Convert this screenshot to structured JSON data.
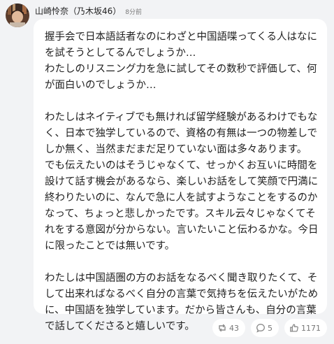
{
  "post": {
    "author_name": "山崎怜奈（乃木坂46）",
    "timestamp": "8分前",
    "body": [
      "握手会で日本語話者なのにわざと中国語喋ってくる人はなにを試そうとしてるんでしょうか…\nわたしのリスニング力を急に試してその数秒で評価して、何が面白いのでしょうか…",
      "わたしはネイティブでも無ければ留学経験があるわけでもなく、日本で独学しているので、資格の有無は一つの物差しでしか無く、当然まだまだ足りていない面は多々あります。\nでも伝えたいのはそうじゃなくて、せっかくお互いに時間を設けて話す機会があるなら、楽しいお話をして笑顔で円満に終わりたいのに、なんで急に人を試すようなことをするのかなって、ちょっと悲しかったです。スキル云々じゃなくてそれをする意図が分からない。言いたいこと伝わるかな。今日に限ったことでは無いです。",
      "わたしは中国語圏の方のお話をなるべく聞き取りたくて、そして出来ればなるべく自分の言葉で気持ちを伝えたいがために、中国語を独学しています。だから皆さんも、自分の言葉で話してくださると嬉しいです。"
    ]
  },
  "actions": {
    "repost": {
      "icon": "repost-icon",
      "count": "43"
    },
    "comment": {
      "icon": "comment-icon",
      "count": "5"
    },
    "like": {
      "icon": "like-icon",
      "count": "1171"
    }
  },
  "colors": {
    "background": "#f2f3f5",
    "bubble": "#ffffff",
    "text": "#1f1f1f",
    "muted": "#7a7a7a"
  }
}
